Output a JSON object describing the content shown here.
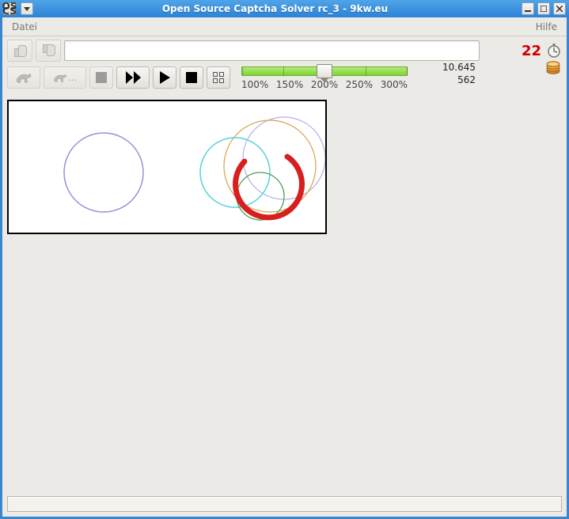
{
  "window": {
    "title": "Open Source Captcha Solver rc_3 - 9kw.eu",
    "app_icon_text_top": "OS",
    "app_icon_text_bot": "CS"
  },
  "menu": {
    "file": "Datei",
    "help": "Hilfe"
  },
  "stats": {
    "countdown": "22",
    "balance": "10.645",
    "queue": "562"
  },
  "slider": {
    "value_percent": 200,
    "ticks": [
      "100%",
      "150%",
      "200%",
      "250%",
      "300%"
    ]
  },
  "icons": {
    "thumbs_up": "thumbs-up-icon",
    "thumbs_down": "thumbs-down-icon",
    "horse": "horse-icon",
    "horse_more": "horse-ellipsis-icon",
    "stop_gray": "stop-gray-icon",
    "fast_forward": "fast-forward-icon",
    "play": "play-icon",
    "stop_black": "stop-black-icon",
    "settings_sliders": "sliders-icon",
    "stopwatch": "stopwatch-icon",
    "coins": "coins-icon",
    "minimize": "minimize-icon",
    "maximize": "maximize-icon",
    "close": "close-icon",
    "menu_arrow": "window-menu-icon"
  },
  "input": {
    "value": "",
    "placeholder": ""
  },
  "statusbar": {
    "text": ""
  }
}
